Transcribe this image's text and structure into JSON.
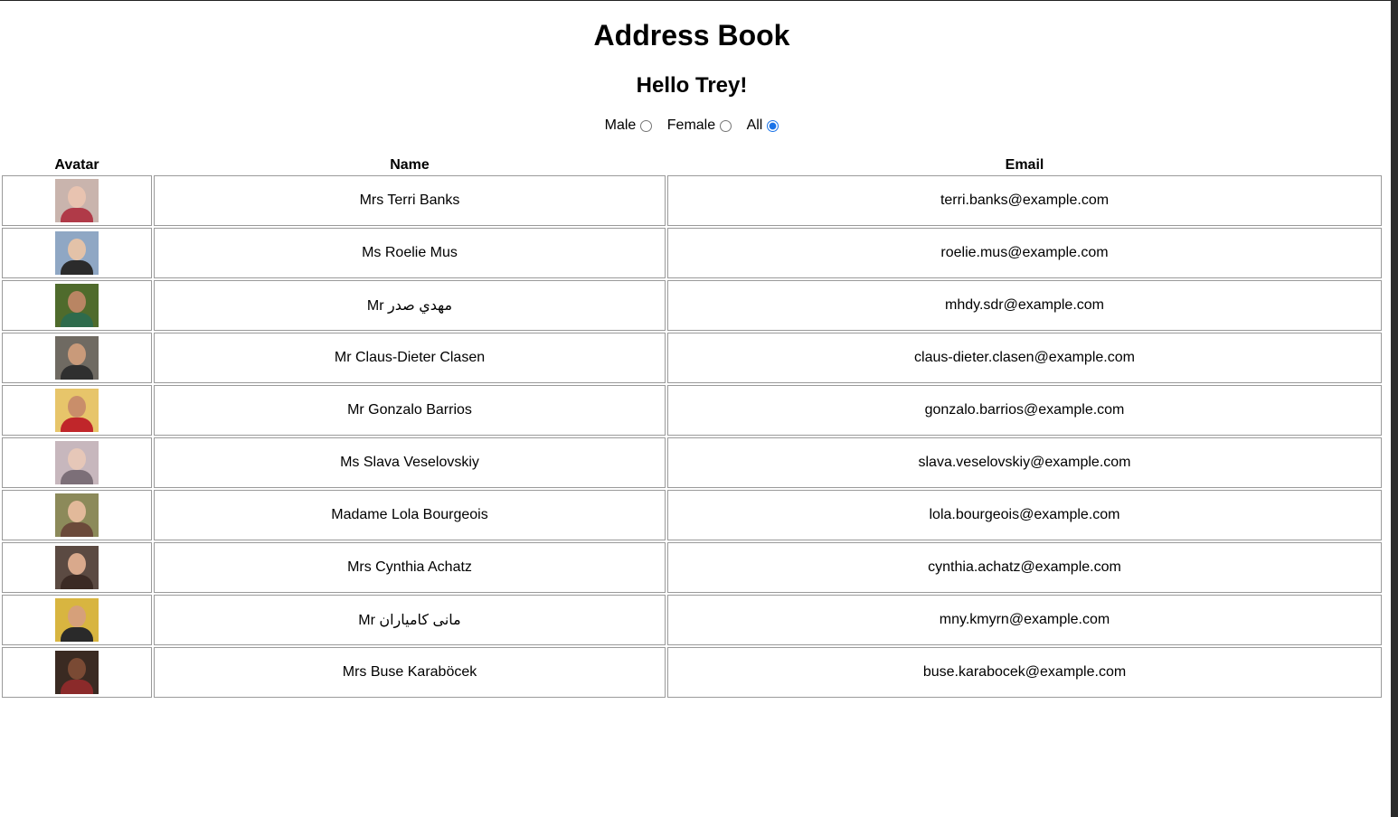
{
  "page": {
    "title": "Address Book",
    "greeting": "Hello Trey!"
  },
  "filters": {
    "options": [
      {
        "label": "Male",
        "checked": false
      },
      {
        "label": "Female",
        "checked": false
      },
      {
        "label": "All",
        "checked": true
      }
    ]
  },
  "table": {
    "headers": {
      "avatar": "Avatar",
      "name": "Name",
      "email": "Email"
    },
    "rows": [
      {
        "name": "Mrs Terri Banks",
        "email": "terri.banks@example.com",
        "avatar": {
          "bg": "#c9b4ad",
          "skin": "#e8c3b0",
          "shirt": "#b03a48"
        }
      },
      {
        "name": "Ms Roelie Mus",
        "email": "roelie.mus@example.com",
        "avatar": {
          "bg": "#8fa7c4",
          "skin": "#e3c2a8",
          "shirt": "#2b2b2b"
        }
      },
      {
        "name": "Mr مهدي صدر",
        "email": "mhdy.sdr@example.com",
        "avatar": {
          "bg": "#4f6b2c",
          "skin": "#b98563",
          "shirt": "#2e6b4c"
        }
      },
      {
        "name": "Mr Claus-Dieter Clasen",
        "email": "claus-dieter.clasen@example.com",
        "avatar": {
          "bg": "#6f6a62",
          "skin": "#c99a7a",
          "shirt": "#2f2f2f"
        }
      },
      {
        "name": "Mr Gonzalo Barrios",
        "email": "gonzalo.barrios@example.com",
        "avatar": {
          "bg": "#e7c56a",
          "skin": "#c98e6a",
          "shirt": "#c0262a"
        }
      },
      {
        "name": "Ms Slava Veselovskiy",
        "email": "slava.veselovskiy@example.com",
        "avatar": {
          "bg": "#c7b7bd",
          "skin": "#e6c7b8",
          "shirt": "#7c6f78"
        }
      },
      {
        "name": "Madame Lola Bourgeois",
        "email": "lola.bourgeois@example.com",
        "avatar": {
          "bg": "#8c8a5a",
          "skin": "#e2b99a",
          "shirt": "#6b4a3a"
        }
      },
      {
        "name": "Mrs Cynthia Achatz",
        "email": "cynthia.achatz@example.com",
        "avatar": {
          "bg": "#5b4a42",
          "skin": "#d9a98c",
          "shirt": "#3b2a24"
        }
      },
      {
        "name": "Mr مانی کامیاران",
        "email": "mny.kmyrn@example.com",
        "avatar": {
          "bg": "#d8b540",
          "skin": "#d6a07a",
          "shirt": "#2a2a2a"
        }
      },
      {
        "name": "Mrs Buse Karaböcek",
        "email": "buse.karabocek@example.com",
        "avatar": {
          "bg": "#3a2a22",
          "skin": "#7a4a34",
          "shirt": "#8b2a2a"
        }
      }
    ]
  }
}
